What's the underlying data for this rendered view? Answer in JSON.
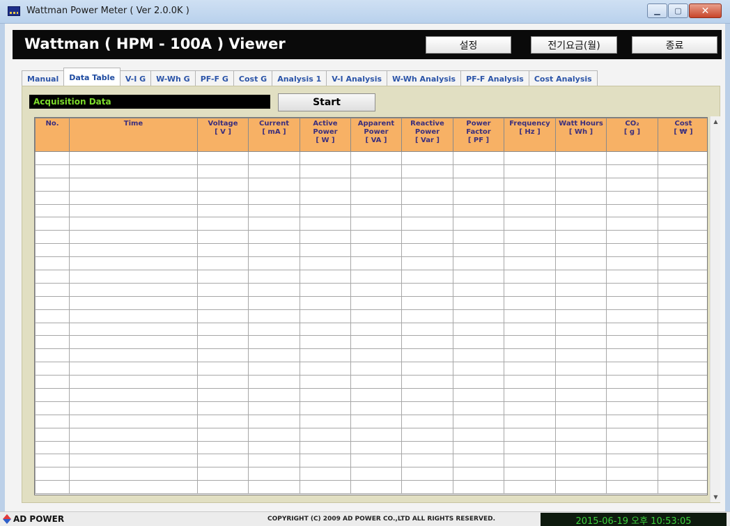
{
  "window": {
    "title": "Wattman Power Meter ( Ver 2.0.0K )",
    "controls": {
      "minimize": "▁",
      "maximize": "▢",
      "close": "✕"
    }
  },
  "header": {
    "title": "Wattman ( HPM - 100A ) Viewer",
    "settings_label": "설정",
    "tariff_label": "전기요금(월)",
    "exit_label": "종료"
  },
  "tabs": [
    {
      "label": "Manual",
      "active": false
    },
    {
      "label": "Data Table",
      "active": true
    },
    {
      "label": "V-I G",
      "active": false
    },
    {
      "label": "W-Wh G",
      "active": false
    },
    {
      "label": "PF-F G",
      "active": false
    },
    {
      "label": "Cost G",
      "active": false
    },
    {
      "label": "Analysis 1",
      "active": false
    },
    {
      "label": "V-I Analysis",
      "active": false
    },
    {
      "label": "W-Wh Analysis",
      "active": false
    },
    {
      "label": "PF-F Analysis",
      "active": false
    },
    {
      "label": "Cost Analysis",
      "active": false
    }
  ],
  "panel": {
    "section_label": "Acquisition Data",
    "start_label": "Start"
  },
  "table": {
    "columns": [
      {
        "name": "No.",
        "unit": ""
      },
      {
        "name": "Time",
        "unit": ""
      },
      {
        "name": "Voltage",
        "unit": "[ V ]"
      },
      {
        "name": "Current",
        "unit": "[ mA ]"
      },
      {
        "name": "Active Power",
        "unit": "[ W ]"
      },
      {
        "name": "Apparent Power",
        "unit": "[ VA ]"
      },
      {
        "name": "Reactive Power",
        "unit": "[ Var ]"
      },
      {
        "name": "Power Factor",
        "unit": "[ PF ]"
      },
      {
        "name": "Frequency",
        "unit": "[ Hz ]"
      },
      {
        "name": "Watt Hours",
        "unit": "[ Wh ]"
      },
      {
        "name": "CO₂",
        "unit": "[ g ]"
      },
      {
        "name": "Cost",
        "unit": "[ ₩ ]"
      }
    ],
    "empty_rows": 26
  },
  "scrollbar": {
    "up": "▲",
    "down": "▼"
  },
  "statusbar": {
    "logo": "AD POWER",
    "copyright": "COPYRIGHT (C) 2009 AD POWER CO.,LTD ALL RIGHTS RESERVED.",
    "clock": "2015-06-19 오후 10:53:05"
  },
  "colors": {
    "header_bg": "#0a0a0a",
    "panel_bg": "#e1dfc2",
    "column_header_bg": "#f7b165",
    "acq_text": "#7ddc2b",
    "tab_text": "#2b54a8",
    "clock_text": "#3cd13c"
  }
}
